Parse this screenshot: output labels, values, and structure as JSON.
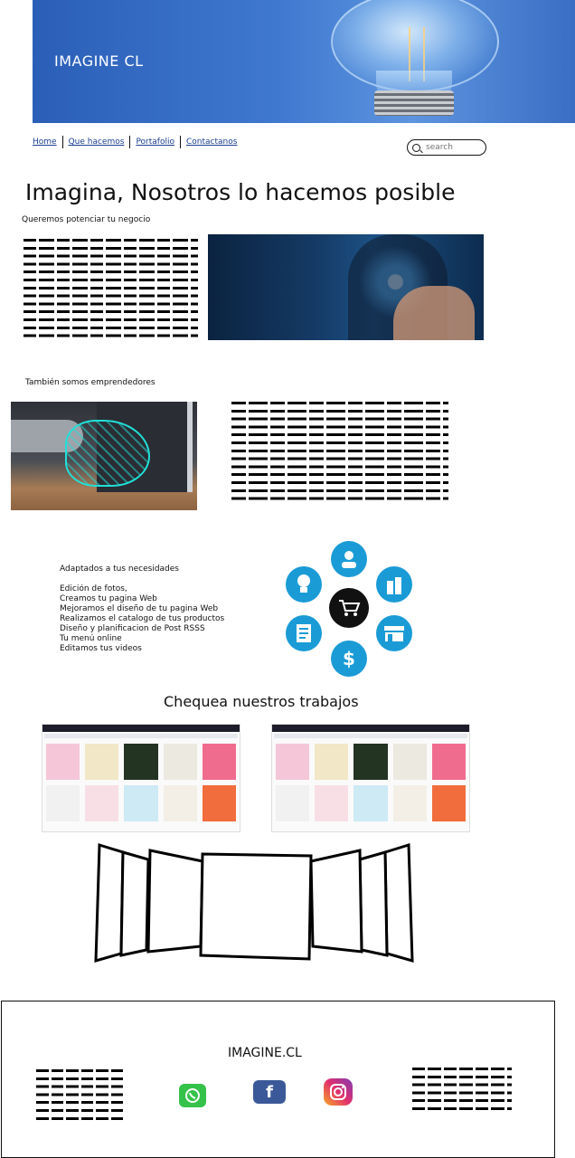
{
  "header": {
    "brand": "IMAGINE CL"
  },
  "nav": {
    "items": [
      "Home",
      "Que hacemos",
      "Portafolio",
      "Contactanos"
    ]
  },
  "search": {
    "placeholder": "search"
  },
  "hero": {
    "title": "Imagina, Nosotros lo hacemos posible",
    "subtitle": "Queremos potenciar tu negocio"
  },
  "section2": {
    "title": "También somos emprendedores"
  },
  "services": {
    "heading": "Adaptados a tus necesidades",
    "items": [
      "Edición de fotos,",
      "Creamos  tu pagina Web",
      "Mejoramos el diseño de tu pagina Web",
      "Realizamos el catalogo de tus productos",
      "Diseño y planificacion de Post RSSS",
      "Tu menú online",
      "Editamos tus videos"
    ],
    "icons": [
      "user-icon",
      "bottle-icon",
      "store-icon",
      "dollar-icon",
      "document-icon",
      "lightbulb-icon",
      "cart-icon"
    ],
    "accent": "#1a9bd6"
  },
  "work": {
    "title": "Chequea nuestros trabajos"
  },
  "footer": {
    "brand": "IMAGINE.CL",
    "social": [
      "whatsapp-icon",
      "facebook-icon",
      "instagram-icon"
    ]
  }
}
